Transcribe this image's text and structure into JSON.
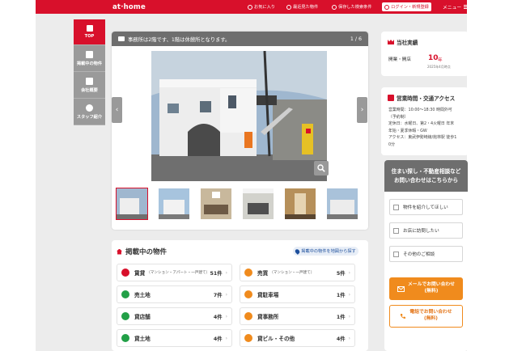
{
  "header": {
    "logo": "at·home",
    "nav": [
      {
        "label": "お気に入り",
        "icon": "heart-icon"
      },
      {
        "label": "最近見た物件",
        "icon": "clock-icon"
      },
      {
        "label": "保存した検索条件",
        "icon": "bell-icon"
      }
    ],
    "login_label": "ログイン・新規登録",
    "menu_label": "メニュー"
  },
  "sidenav": [
    {
      "label": "TOP",
      "icon": "top-icon",
      "active": true
    },
    {
      "label": "掲載中の物件",
      "icon": "building-icon"
    },
    {
      "label": "会社概要",
      "icon": "document-icon"
    },
    {
      "label": "スタッフ紹介",
      "icon": "staff-icon"
    }
  ],
  "gallery": {
    "caption": "事務所は2階です、1階は休憩所となります。",
    "pager": "1 / 6",
    "thumb_count": 6
  },
  "listings": {
    "title": "掲載中の物件",
    "map_button": "掲載中の物件を地図から探す",
    "categories": [
      {
        "name": "賃貸",
        "sub": "（マンション・アパート・一戸建て）",
        "count": "51件",
        "color": "#d8102b"
      },
      {
        "name": "売買",
        "sub": "（マンション・一戸建て）",
        "count": "5件",
        "color": "#f08b1d"
      },
      {
        "name": "売土地",
        "sub": "",
        "count": "7件",
        "color": "#22a047"
      },
      {
        "name": "貸駐車場",
        "sub": "",
        "count": "1件",
        "color": "#f08b1d"
      },
      {
        "name": "貸店舗",
        "sub": "",
        "count": "4件",
        "color": "#22a047"
      },
      {
        "name": "貸事務所",
        "sub": "",
        "count": "1件",
        "color": "#f08b1d"
      },
      {
        "name": "貸土地",
        "sub": "",
        "count": "4件",
        "color": "#22a047"
      },
      {
        "name": "貸ビル・その他",
        "sub": "",
        "count": "4件",
        "color": "#f08b1d"
      }
    ]
  },
  "achievements": {
    "title": "当社実績",
    "label": "開業・開店",
    "years": "10",
    "years_unit": "年",
    "note": "2025年4月時点"
  },
  "hours": {
    "title": "営業時間・交通アクセス",
    "lines": [
      "営業時間：10:00～18:30 時間外可",
      "（予約制）",
      "定休日：水曜日、第2・4火曜日 年末",
      "年始・夏季休暇・GW",
      "アクセス：東武伊勢崎線/館林駅 徒歩1",
      "0分"
    ]
  },
  "consult": {
    "head_line1": "住まい探し・不動産相談など",
    "head_line2": "お問い合わせはこちらから",
    "options": [
      "物件を紹介してほしい",
      "お店に訪問したい",
      "その他のご相談"
    ],
    "mail_button_line1": "メールでお問い合わせ",
    "mail_button_line2": "(無料)",
    "tel_button_line1": "電話でお問い合わせ",
    "tel_button_line2": "(無料)"
  }
}
